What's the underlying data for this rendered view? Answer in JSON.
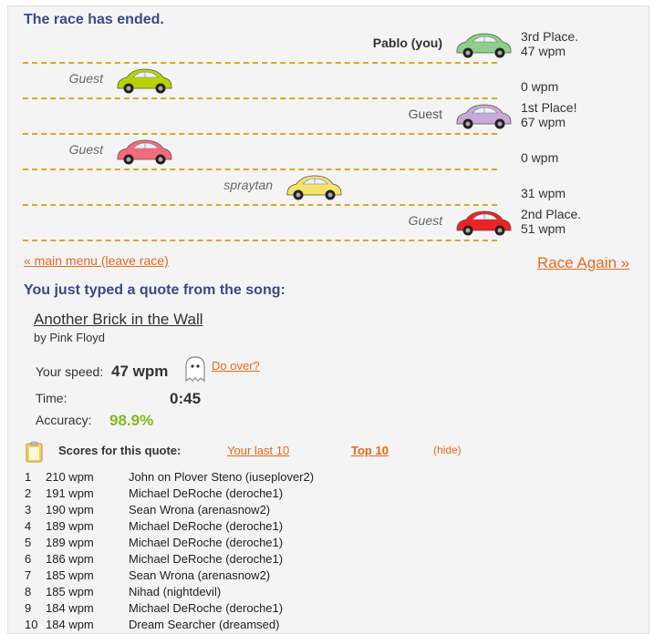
{
  "race": {
    "heading": "The race has ended.",
    "lanes": [
      {
        "name": "Pablo (you)",
        "name_style": "you",
        "result_line1": "3rd Place.",
        "result_line2": "47 wpm",
        "car_color": "#8fcf8a",
        "progress": 1.0
      },
      {
        "name": "Guest",
        "name_style": "guest",
        "result_line1": "",
        "result_line2": "0 wpm",
        "car_color": "#b8d400",
        "progress": 0.0
      },
      {
        "name": "Guest",
        "name_style": "plain",
        "result_line1": "1st Place!",
        "result_line2": "67 wpm",
        "car_color": "#c9a9d8",
        "progress": 1.0
      },
      {
        "name": "Guest",
        "name_style": "guest",
        "result_line1": "",
        "result_line2": "0 wpm",
        "car_color": "#f56b7a",
        "progress": 0.0
      },
      {
        "name": "spraytan",
        "name_style": "guest",
        "result_line1": "",
        "result_line2": "31 wpm",
        "car_color": "#f2e46a",
        "progress": 0.5
      },
      {
        "name": "Guest",
        "name_style": "guest",
        "result_line1": "2nd Place.",
        "result_line2": "51 wpm",
        "car_color": "#ee2222",
        "progress": 1.0
      }
    ],
    "main_menu_link": "« main menu (leave race)",
    "race_again_link": "Race Again »"
  },
  "quote": {
    "heading": "You just typed a quote from the song:",
    "title": "Another Brick in the Wall",
    "artist": "by Pink Floyd"
  },
  "stats": {
    "speed_label": "Your speed:",
    "speed_value": "47 wpm",
    "do_over": "Do over?",
    "time_label": "Time:",
    "time_value": "0:45",
    "accuracy_label": "Accuracy:",
    "accuracy_value": "98.9%"
  },
  "scores": {
    "heading": "Scores for this quote:",
    "tab_last10": "Your last 10",
    "tab_top10": "Top 10",
    "hide": "(hide)",
    "rows": [
      {
        "rank": "1",
        "wpm": "210 wpm",
        "name": "John on Plover Steno (iuseplover2)"
      },
      {
        "rank": "2",
        "wpm": "191 wpm",
        "name": "Michael DeRoche (deroche1)"
      },
      {
        "rank": "3",
        "wpm": "190 wpm",
        "name": "Sean Wrona (arenasnow2)"
      },
      {
        "rank": "4",
        "wpm": "189 wpm",
        "name": "Michael DeRoche (deroche1)"
      },
      {
        "rank": "5",
        "wpm": "189 wpm",
        "name": "Michael DeRoche (deroche1)"
      },
      {
        "rank": "6",
        "wpm": "186 wpm",
        "name": "Michael DeRoche (deroche1)"
      },
      {
        "rank": "7",
        "wpm": "185 wpm",
        "name": "Sean Wrona (arenasnow2)"
      },
      {
        "rank": "8",
        "wpm": "185 wpm",
        "name": "Nihad (nightdevil)"
      },
      {
        "rank": "9",
        "wpm": "184 wpm",
        "name": "Michael DeRoche (deroche1)"
      },
      {
        "rank": "10",
        "wpm": "184 wpm",
        "name": "Dream Searcher (dreamsed)"
      }
    ]
  }
}
